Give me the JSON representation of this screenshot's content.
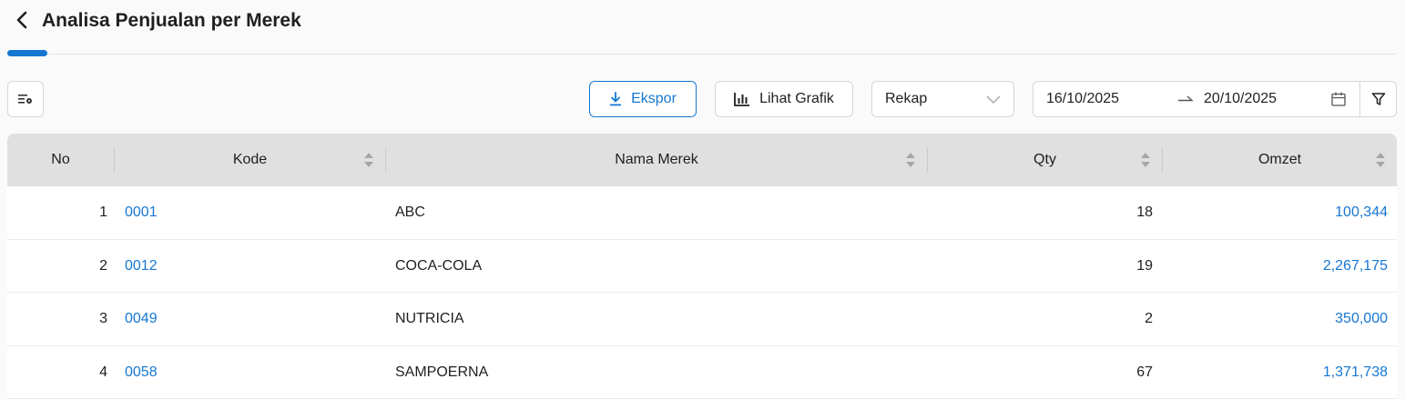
{
  "header": {
    "title": "Analisa Penjualan per Merek"
  },
  "toolbar": {
    "export_label": "Ekspor",
    "chart_label": "Lihat Grafik",
    "mode_value": "Rekap",
    "date_start": "16/10/2025",
    "date_end": "20/10/2025"
  },
  "table": {
    "columns": {
      "no": "No",
      "kode": "Kode",
      "nama": "Nama Merek",
      "qty": "Qty",
      "omzet": "Omzet"
    },
    "rows": [
      {
        "no": "1",
        "kode": "0001",
        "nama": "ABC",
        "qty": "18",
        "omzet": "100,344"
      },
      {
        "no": "2",
        "kode": "0012",
        "nama": "COCA-COLA",
        "qty": "19",
        "omzet": "2,267,175"
      },
      {
        "no": "3",
        "kode": "0049",
        "nama": "NUTRICIA",
        "qty": "2",
        "omzet": "350,000"
      },
      {
        "no": "4",
        "kode": "0058",
        "nama": "SAMPOERNA",
        "qty": "67",
        "omzet": "1,371,738"
      }
    ]
  },
  "colors": {
    "accent": "#1677d2",
    "header_bg": "#e0e0e0",
    "page_bg": "#fafafa"
  }
}
